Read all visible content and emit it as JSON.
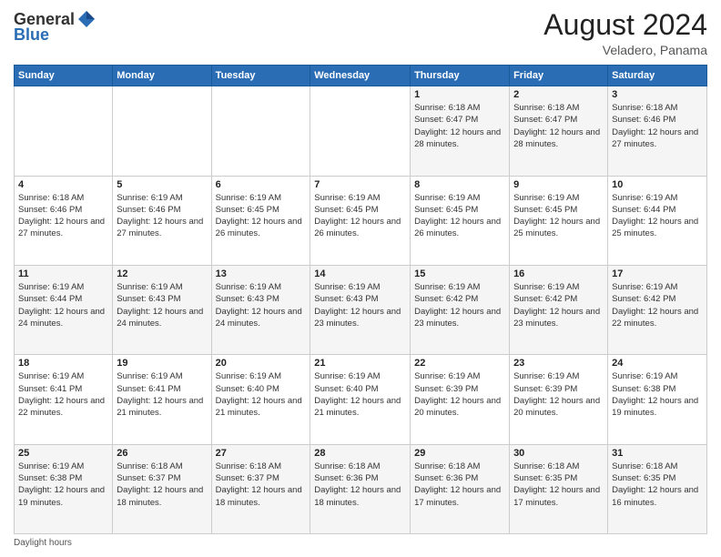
{
  "logo": {
    "general": "General",
    "blue": "Blue"
  },
  "header": {
    "month_year": "August 2024",
    "location": "Veladero, Panama"
  },
  "days_of_week": [
    "Sunday",
    "Monday",
    "Tuesday",
    "Wednesday",
    "Thursday",
    "Friday",
    "Saturday"
  ],
  "footer": {
    "daylight_label": "Daylight hours"
  },
  "weeks": [
    [
      {
        "day": "",
        "sunrise": "",
        "sunset": "",
        "daylight": ""
      },
      {
        "day": "",
        "sunrise": "",
        "sunset": "",
        "daylight": ""
      },
      {
        "day": "",
        "sunrise": "",
        "sunset": "",
        "daylight": ""
      },
      {
        "day": "",
        "sunrise": "",
        "sunset": "",
        "daylight": ""
      },
      {
        "day": "1",
        "sunrise": "Sunrise: 6:18 AM",
        "sunset": "Sunset: 6:47 PM",
        "daylight": "Daylight: 12 hours and 28 minutes."
      },
      {
        "day": "2",
        "sunrise": "Sunrise: 6:18 AM",
        "sunset": "Sunset: 6:47 PM",
        "daylight": "Daylight: 12 hours and 28 minutes."
      },
      {
        "day": "3",
        "sunrise": "Sunrise: 6:18 AM",
        "sunset": "Sunset: 6:46 PM",
        "daylight": "Daylight: 12 hours and 27 minutes."
      }
    ],
    [
      {
        "day": "4",
        "sunrise": "Sunrise: 6:18 AM",
        "sunset": "Sunset: 6:46 PM",
        "daylight": "Daylight: 12 hours and 27 minutes."
      },
      {
        "day": "5",
        "sunrise": "Sunrise: 6:19 AM",
        "sunset": "Sunset: 6:46 PM",
        "daylight": "Daylight: 12 hours and 27 minutes."
      },
      {
        "day": "6",
        "sunrise": "Sunrise: 6:19 AM",
        "sunset": "Sunset: 6:45 PM",
        "daylight": "Daylight: 12 hours and 26 minutes."
      },
      {
        "day": "7",
        "sunrise": "Sunrise: 6:19 AM",
        "sunset": "Sunset: 6:45 PM",
        "daylight": "Daylight: 12 hours and 26 minutes."
      },
      {
        "day": "8",
        "sunrise": "Sunrise: 6:19 AM",
        "sunset": "Sunset: 6:45 PM",
        "daylight": "Daylight: 12 hours and 26 minutes."
      },
      {
        "day": "9",
        "sunrise": "Sunrise: 6:19 AM",
        "sunset": "Sunset: 6:45 PM",
        "daylight": "Daylight: 12 hours and 25 minutes."
      },
      {
        "day": "10",
        "sunrise": "Sunrise: 6:19 AM",
        "sunset": "Sunset: 6:44 PM",
        "daylight": "Daylight: 12 hours and 25 minutes."
      }
    ],
    [
      {
        "day": "11",
        "sunrise": "Sunrise: 6:19 AM",
        "sunset": "Sunset: 6:44 PM",
        "daylight": "Daylight: 12 hours and 24 minutes."
      },
      {
        "day": "12",
        "sunrise": "Sunrise: 6:19 AM",
        "sunset": "Sunset: 6:43 PM",
        "daylight": "Daylight: 12 hours and 24 minutes."
      },
      {
        "day": "13",
        "sunrise": "Sunrise: 6:19 AM",
        "sunset": "Sunset: 6:43 PM",
        "daylight": "Daylight: 12 hours and 24 minutes."
      },
      {
        "day": "14",
        "sunrise": "Sunrise: 6:19 AM",
        "sunset": "Sunset: 6:43 PM",
        "daylight": "Daylight: 12 hours and 23 minutes."
      },
      {
        "day": "15",
        "sunrise": "Sunrise: 6:19 AM",
        "sunset": "Sunset: 6:42 PM",
        "daylight": "Daylight: 12 hours and 23 minutes."
      },
      {
        "day": "16",
        "sunrise": "Sunrise: 6:19 AM",
        "sunset": "Sunset: 6:42 PM",
        "daylight": "Daylight: 12 hours and 23 minutes."
      },
      {
        "day": "17",
        "sunrise": "Sunrise: 6:19 AM",
        "sunset": "Sunset: 6:42 PM",
        "daylight": "Daylight: 12 hours and 22 minutes."
      }
    ],
    [
      {
        "day": "18",
        "sunrise": "Sunrise: 6:19 AM",
        "sunset": "Sunset: 6:41 PM",
        "daylight": "Daylight: 12 hours and 22 minutes."
      },
      {
        "day": "19",
        "sunrise": "Sunrise: 6:19 AM",
        "sunset": "Sunset: 6:41 PM",
        "daylight": "Daylight: 12 hours and 21 minutes."
      },
      {
        "day": "20",
        "sunrise": "Sunrise: 6:19 AM",
        "sunset": "Sunset: 6:40 PM",
        "daylight": "Daylight: 12 hours and 21 minutes."
      },
      {
        "day": "21",
        "sunrise": "Sunrise: 6:19 AM",
        "sunset": "Sunset: 6:40 PM",
        "daylight": "Daylight: 12 hours and 21 minutes."
      },
      {
        "day": "22",
        "sunrise": "Sunrise: 6:19 AM",
        "sunset": "Sunset: 6:39 PM",
        "daylight": "Daylight: 12 hours and 20 minutes."
      },
      {
        "day": "23",
        "sunrise": "Sunrise: 6:19 AM",
        "sunset": "Sunset: 6:39 PM",
        "daylight": "Daylight: 12 hours and 20 minutes."
      },
      {
        "day": "24",
        "sunrise": "Sunrise: 6:19 AM",
        "sunset": "Sunset: 6:38 PM",
        "daylight": "Daylight: 12 hours and 19 minutes."
      }
    ],
    [
      {
        "day": "25",
        "sunrise": "Sunrise: 6:19 AM",
        "sunset": "Sunset: 6:38 PM",
        "daylight": "Daylight: 12 hours and 19 minutes."
      },
      {
        "day": "26",
        "sunrise": "Sunrise: 6:18 AM",
        "sunset": "Sunset: 6:37 PM",
        "daylight": "Daylight: 12 hours and 18 minutes."
      },
      {
        "day": "27",
        "sunrise": "Sunrise: 6:18 AM",
        "sunset": "Sunset: 6:37 PM",
        "daylight": "Daylight: 12 hours and 18 minutes."
      },
      {
        "day": "28",
        "sunrise": "Sunrise: 6:18 AM",
        "sunset": "Sunset: 6:36 PM",
        "daylight": "Daylight: 12 hours and 18 minutes."
      },
      {
        "day": "29",
        "sunrise": "Sunrise: 6:18 AM",
        "sunset": "Sunset: 6:36 PM",
        "daylight": "Daylight: 12 hours and 17 minutes."
      },
      {
        "day": "30",
        "sunrise": "Sunrise: 6:18 AM",
        "sunset": "Sunset: 6:35 PM",
        "daylight": "Daylight: 12 hours and 17 minutes."
      },
      {
        "day": "31",
        "sunrise": "Sunrise: 6:18 AM",
        "sunset": "Sunset: 6:35 PM",
        "daylight": "Daylight: 12 hours and 16 minutes."
      }
    ]
  ]
}
